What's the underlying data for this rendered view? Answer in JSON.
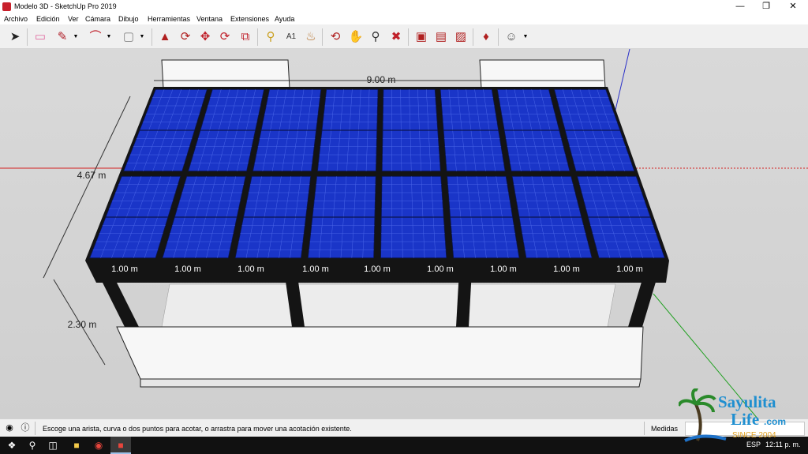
{
  "window": {
    "title": "Modelo 3D - SketchUp Pro 2019",
    "minimize_icon": "minimize-icon",
    "maximize_icon": "restore-icon",
    "close_icon": "close-icon"
  },
  "menu": {
    "items": [
      "Archivo",
      "Edición",
      "Ver",
      "Cámara",
      "Dibujo",
      "Herramientas",
      "Ventana",
      "Extensiones",
      "Ayuda"
    ]
  },
  "toolbar": {
    "tools": [
      "select-icon",
      "eraser-icon",
      "pencil-icon",
      "arc-icon",
      "rectangle-icon",
      "push-pull-icon",
      "offset-icon",
      "move-icon",
      "rotate-icon",
      "scale-icon",
      "tape-measure-icon",
      "text-icon",
      "paint-bucket-icon",
      "orbit-icon",
      "pan-icon",
      "zoom-icon",
      "zoom-extents-icon",
      "warehouse-icon",
      "extension-warehouse-icon",
      "layout-icon",
      "extension-manager-icon",
      "ruby-icon",
      "account-icon"
    ]
  },
  "model": {
    "dim_length": "9.00 m",
    "dim_depth": "4.67 m",
    "dim_height": "2.30 m",
    "panel_gap_label": "1.00 m",
    "panel_color": "#1a35c8",
    "frame_color": "#141414",
    "wall_color": "#f4f4f4"
  },
  "status": {
    "geo_icon": "geolocation-icon",
    "info_icon": "info-icon",
    "message": "Escoge una arista, curva o dos puntos para acotar, o arrastra para mover una acotación existente.",
    "measurements_label": "Medidas"
  },
  "taskbar": {
    "apps": [
      "windows-start-icon",
      "search-icon",
      "task-view-icon",
      "file-explorer-icon",
      "chrome-icon",
      "sketchup-icon"
    ],
    "language": "ESP",
    "time": "12:11 p. m."
  },
  "watermark": {
    "line1": "Sayulita",
    "line2": "Life",
    "line2_suffix": ".com",
    "line3": "SINCE 2004"
  }
}
